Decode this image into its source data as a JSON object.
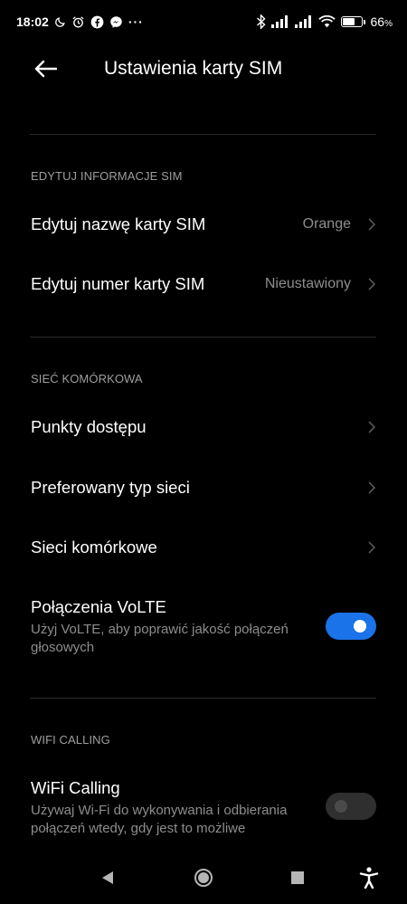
{
  "status_bar": {
    "time": "18:02",
    "left_icons": [
      "moon-icon",
      "alarm-icon",
      "facebook-icon",
      "messenger-icon",
      "more-dots-icon"
    ],
    "right_icons": [
      "bluetooth-icon",
      "signal-icon",
      "signal-icon",
      "wifi-icon"
    ],
    "battery_percent": "66",
    "battery_level": 0.66
  },
  "header": {
    "back_icon": "arrow-left-icon",
    "title": "Ustawienia karty SIM"
  },
  "sections": {
    "edit_info": {
      "header": "EDYTUJ INFORMACJE SIM",
      "sim_name": {
        "label": "Edytuj nazwę karty SIM",
        "value": "Orange"
      },
      "sim_number": {
        "label": "Edytuj numer karty SIM",
        "value": "Nieustawiony"
      }
    },
    "cellular": {
      "header": "SIEĆ KOMÓRKOWA",
      "access_points": {
        "label": "Punkty dostępu"
      },
      "preferred_network": {
        "label": "Preferowany typ sieci"
      },
      "mobile_networks": {
        "label": "Sieci komórkowe"
      },
      "volte": {
        "label": "Połączenia VoLTE",
        "description": "Użyj VoLTE, aby poprawić jakość połączeń głosowych",
        "enabled": true
      }
    },
    "wifi_calling": {
      "header": "WIFI CALLING",
      "wifi_calling": {
        "label": "WiFi Calling",
        "description": "Używaj Wi-Fi do wykonywania i odbierania połączeń wtedy, gdy jest to możliwe",
        "enabled": false
      }
    }
  },
  "colors": {
    "background": "#000000",
    "accent": "#1a73e8",
    "secondary_text": "#8d8d8d"
  },
  "nav_bar": [
    "back-triangle-icon",
    "home-circle-icon",
    "recents-square-icon",
    "accessibility-icon"
  ]
}
